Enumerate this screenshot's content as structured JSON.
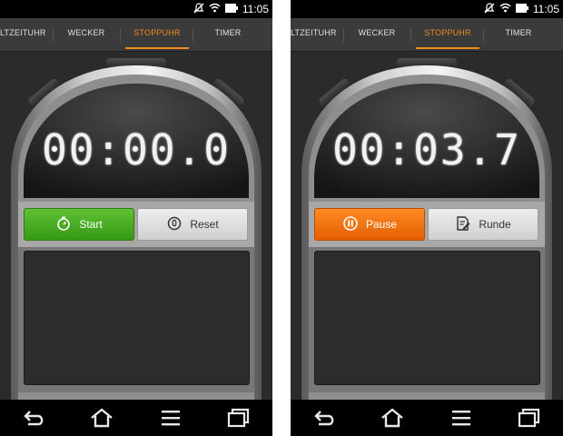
{
  "status": {
    "time": "11:05",
    "icons": [
      "silent-icon",
      "wifi-icon",
      "battery-icon"
    ]
  },
  "tabs": [
    "LTZEITUHR",
    "WECKER",
    "STOPPUHR",
    "TIMER"
  ],
  "active_tab_index": 2,
  "screens": [
    {
      "display": "00:00.0",
      "primary_button": {
        "label": "Start",
        "icon": "stopwatch-icon",
        "color": "#4caf2a"
      },
      "secondary_button": {
        "label": "Reset",
        "icon": "reset-icon"
      }
    },
    {
      "display": "00:03.7",
      "primary_button": {
        "label": "Pause",
        "icon": "pause-icon",
        "color": "#f37416"
      },
      "secondary_button": {
        "label": "Runde",
        "icon": "lap-icon"
      }
    }
  ],
  "nav": [
    "back-icon",
    "home-icon",
    "menu-icon",
    "recent-apps-icon"
  ],
  "colors": {
    "accent": "#f28a1e",
    "background": "#2b2b2b"
  }
}
